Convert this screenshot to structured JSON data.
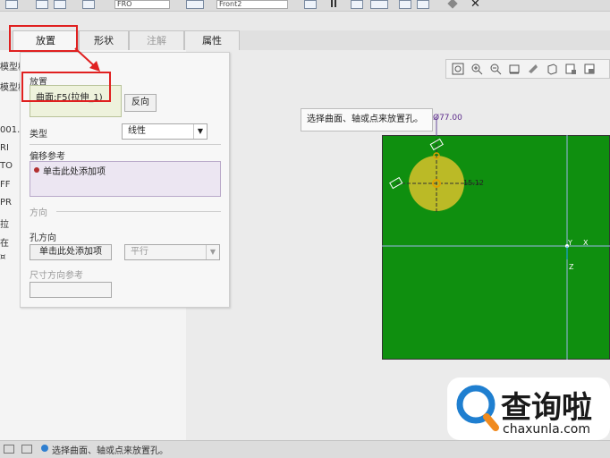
{
  "ribbon": {
    "field_left": "FRO",
    "field_right": "Front2"
  },
  "tabs": [
    {
      "label": "放置"
    },
    {
      "label": "形状"
    },
    {
      "label": "注解"
    },
    {
      "label": "属性"
    }
  ],
  "tree": {
    "rows": [
      "模型树",
      "模型树",
      "001.P",
      "RI",
      "TO",
      "FF",
      "PR",
      "拉",
      "在",
      "¤"
    ]
  },
  "panel": {
    "placement_label": "放置",
    "placement_value": "曲面:F5(拉伸_1)",
    "flip_button": "反向",
    "type_label": "类型",
    "type_value": "线性",
    "offset_ref_label": "偏移参考",
    "offset_ref_item": "单击此处添加项",
    "direction_label": "方向",
    "hole_dir_label": "孔方向",
    "hole_dir_value": "单击此处添加项",
    "parallel_value": "平行",
    "dim_ref_label": "尺寸方向参考"
  },
  "tooltip": {
    "text": "选择曲面、轴或点来放置孔。"
  },
  "canvas": {
    "dim_label": "Ø77.00",
    "dim_small": "15.12",
    "axis_y": "Y",
    "axis_x": "X",
    "axis_z": "Z",
    "green_color": "#0f8f0f",
    "hole_color": "#d9c22a"
  },
  "status": {
    "text": "选择曲面、轴或点来放置孔。"
  },
  "watermark": {
    "brand": "查询啦",
    "url": "chaxunla.com"
  },
  "accent": {
    "highlight_red": "#e02020"
  }
}
